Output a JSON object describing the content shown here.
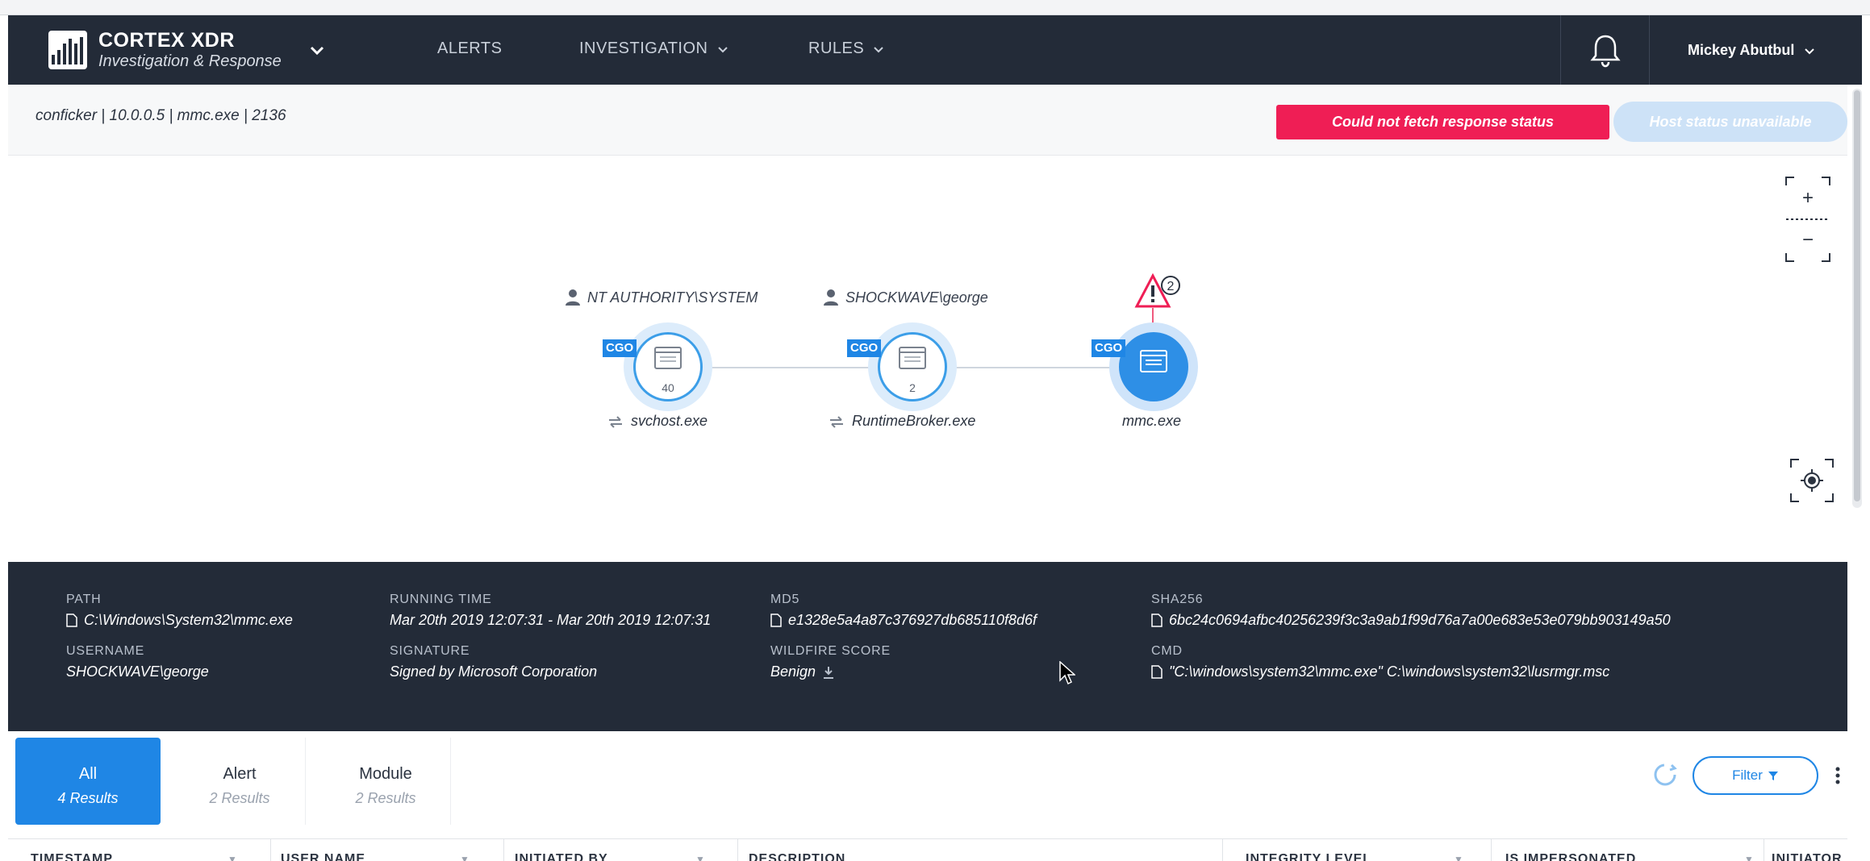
{
  "nav": {
    "brand_title": "CORTEX XDR",
    "brand_subtitle": "Investigation & Response",
    "items": [
      "ALERTS",
      "INVESTIGATION",
      "RULES"
    ],
    "user_name": "Mickey Abutbul"
  },
  "context": {
    "breadcrumb": "conficker | 10.0.0.5 | mmc.exe | 2136",
    "error_button": "Could not fetch response status",
    "host_status_button": "Host status unavailable"
  },
  "graph": {
    "users": [
      "NT AUTHORITY\\SYSTEM",
      "SHOCKWAVE\\george"
    ],
    "nodes": [
      {
        "tag": "CGO",
        "count": "40",
        "name": "svchost.exe"
      },
      {
        "tag": "CGO",
        "count": "2",
        "name": "RuntimeBroker.exe"
      },
      {
        "tag": "CGO",
        "count": "",
        "name": "mmc.exe"
      }
    ],
    "alert_count": "2",
    "zoom_in": "+",
    "zoom_out": "−"
  },
  "details": {
    "path_label": "PATH",
    "path_value": "C:\\Windows\\System32\\mmc.exe",
    "running_time_label": "RUNNING TIME",
    "running_time_value": "Mar 20th 2019 12:07:31 - Mar 20th 2019 12:07:31",
    "md5_label": "MD5",
    "md5_value": "e1328e5a4a87c376927db685110f8d6f",
    "sha256_label": "SHA256",
    "sha256_value": "6bc24c0694afbc40256239f3c3a9ab1f99d76a7a00e683e53e079bb903149a50",
    "username_label": "USERNAME",
    "username_value": "SHOCKWAVE\\george",
    "signature_label": "SIGNATURE",
    "signature_value": "Signed by Microsoft Corporation",
    "wildfire_label": "WILDFIRE SCORE",
    "wildfire_value": "Benign",
    "cmd_label": "CMD",
    "cmd_value": "\"C:\\windows\\system32\\mmc.exe\" C:\\windows\\system32\\lusrmgr.msc"
  },
  "tabs": [
    {
      "title": "All",
      "sub": "4 Results"
    },
    {
      "title": "Alert",
      "sub": "2 Results"
    },
    {
      "title": "Module",
      "sub": "2 Results"
    }
  ],
  "filter_label": "Filter",
  "table": {
    "columns": [
      "TIMESTAMP",
      "USER NAME",
      "INITIATED BY",
      "DESCRIPTION",
      "INTEGRITY LEVEL",
      "IS IMPERSONATED",
      "INITIATOR"
    ]
  },
  "colors": {
    "nav_bg": "#232b38",
    "accent": "#1f86e5",
    "error": "#ef1e55"
  }
}
